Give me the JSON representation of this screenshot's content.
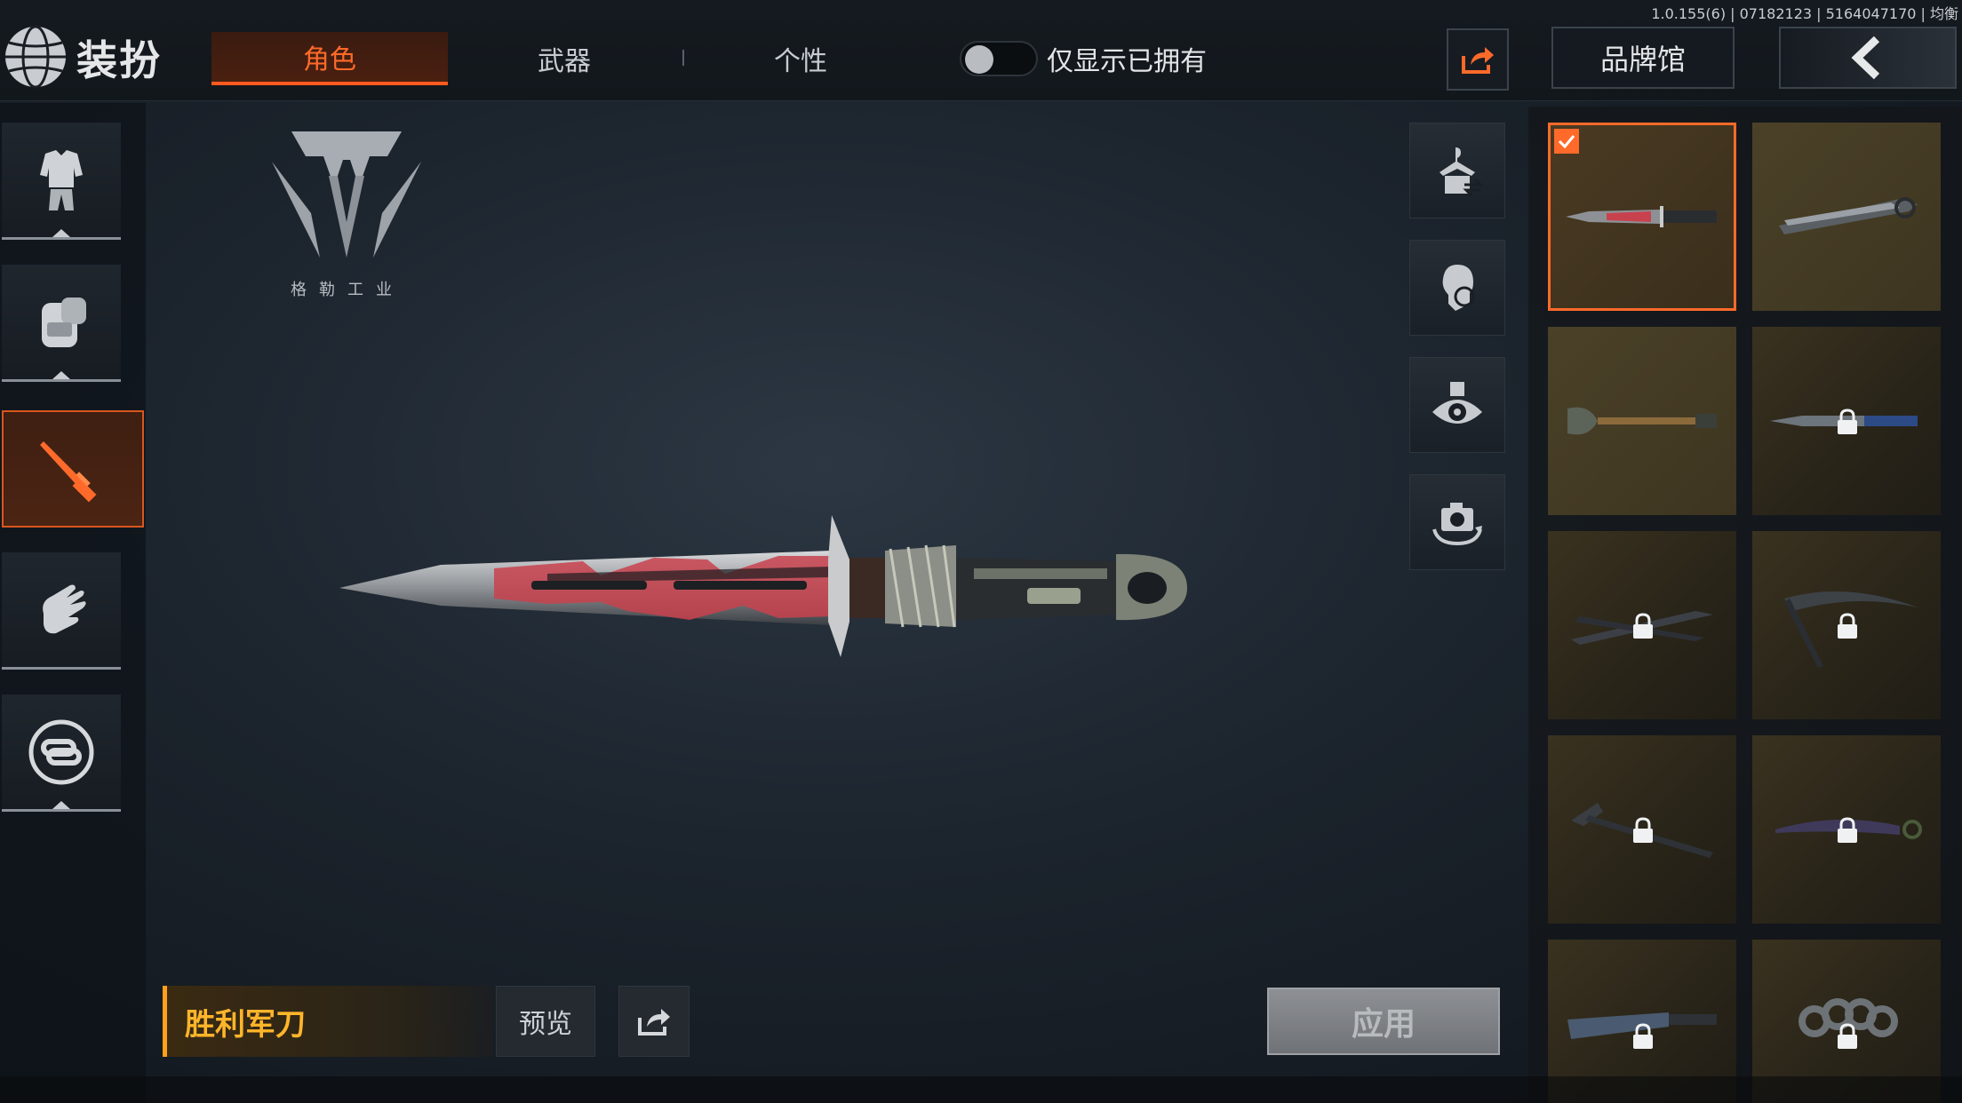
{
  "version_text": "1.0.155(6) | 07182123 | 5164047170 | 均衡",
  "header": {
    "title": "装扮",
    "tabs": [
      {
        "label": "角色",
        "active": true
      },
      {
        "label": "武器",
        "active": false
      },
      {
        "label": "个性",
        "active": false
      }
    ],
    "toggle_label": "仅显示已拥有",
    "toggle_on": false,
    "brand_button": "品牌馆"
  },
  "sidebar": {
    "items": [
      {
        "icon": "outfit-icon",
        "active": false
      },
      {
        "icon": "backpack-icon",
        "active": false
      },
      {
        "icon": "knife-icon",
        "active": true
      },
      {
        "icon": "glove-icon",
        "active": false
      },
      {
        "icon": "chain-link-icon",
        "active": false
      }
    ]
  },
  "brand": {
    "name": "格勒工业",
    "logo": "geller-industry-logo"
  },
  "tools": [
    "wardrobe-swap-icon",
    "head-rotate-icon",
    "eye-view-icon",
    "camera-rotate-icon"
  ],
  "item": {
    "name": "胜利军刀",
    "preview_label": "预览",
    "apply_label": "应用"
  },
  "grid": {
    "items": [
      {
        "name": "knife-victory",
        "selected": true,
        "locked": false
      },
      {
        "name": "knife-folded",
        "selected": false,
        "locked": false
      },
      {
        "name": "shovel",
        "selected": false,
        "locked": false
      },
      {
        "name": "knife-blue",
        "selected": false,
        "locked": true
      },
      {
        "name": "knife-butterfly",
        "selected": false,
        "locked": true
      },
      {
        "name": "pickaxe",
        "selected": false,
        "locked": true
      },
      {
        "name": "ice-axe",
        "selected": false,
        "locked": true
      },
      {
        "name": "karambit",
        "selected": false,
        "locked": true
      },
      {
        "name": "cleaver",
        "selected": false,
        "locked": true
      },
      {
        "name": "knuckles",
        "selected": false,
        "locked": true
      }
    ]
  },
  "colors": {
    "accent": "#ff6a2a",
    "item_name": "#ffb52a"
  }
}
